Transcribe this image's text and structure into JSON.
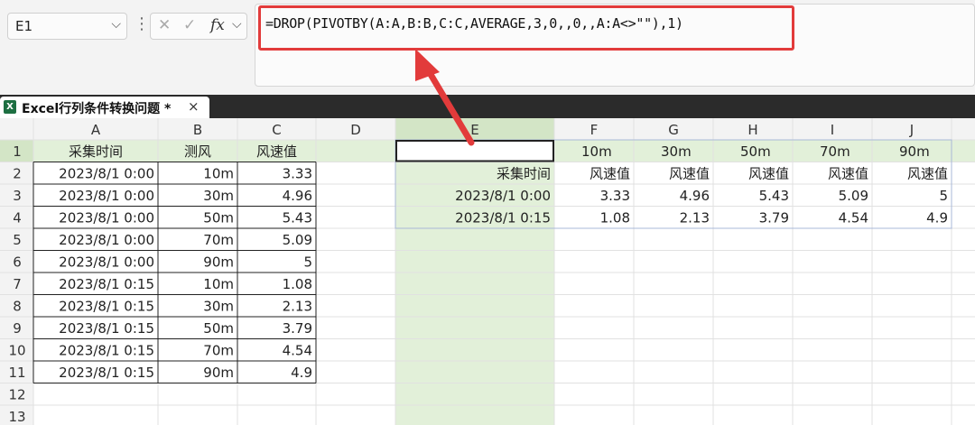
{
  "name_box": {
    "cell": "E1"
  },
  "formula_bar": {
    "fx_symbol": "fx",
    "formula": "=DROP(PIVOTBY(A:A,B:B,C:C,AVERAGE,3,0,,0,,A:A<>\"\"),1)"
  },
  "tab": {
    "title": "Excel行列条件转换问题 *",
    "close": "×"
  },
  "columns": [
    "A",
    "B",
    "C",
    "D",
    "E",
    "F",
    "G",
    "H",
    "I",
    "J"
  ],
  "rows": [
    "1",
    "2",
    "3",
    "4",
    "5",
    "6",
    "7",
    "8",
    "9",
    "10",
    "11",
    "12",
    "13"
  ],
  "source_table": {
    "headers": [
      "采集时间",
      "测风",
      "风速值"
    ],
    "rows": [
      [
        "2023/8/1 0:00",
        "10m",
        "3.33"
      ],
      [
        "2023/8/1 0:00",
        "30m",
        "4.96"
      ],
      [
        "2023/8/1 0:00",
        "50m",
        "5.43"
      ],
      [
        "2023/8/1 0:00",
        "70m",
        "5.09"
      ],
      [
        "2023/8/1 0:00",
        "90m",
        "5"
      ],
      [
        "2023/8/1 0:15",
        "10m",
        "1.08"
      ],
      [
        "2023/8/1 0:15",
        "30m",
        "2.13"
      ],
      [
        "2023/8/1 0:15",
        "50m",
        "3.79"
      ],
      [
        "2023/8/1 0:15",
        "70m",
        "4.54"
      ],
      [
        "2023/8/1 0:15",
        "90m",
        "4.9"
      ]
    ]
  },
  "result_table": {
    "row1": [
      "",
      "10m",
      "30m",
      "50m",
      "70m",
      "90m"
    ],
    "row2": [
      "采集时间",
      "风速值",
      "风速值",
      "风速值",
      "风速值",
      "风速值"
    ],
    "row3": [
      "2023/8/1 0:00",
      "3.33",
      "4.96",
      "5.43",
      "5.09",
      "5"
    ],
    "row4": [
      "2023/8/1 0:15",
      "1.08",
      "2.13",
      "3.79",
      "4.54",
      "4.9"
    ]
  },
  "colors": {
    "highlight": "#e2f0d9",
    "accent": "#e23b3b",
    "spill_border": "#a9b9d8"
  }
}
